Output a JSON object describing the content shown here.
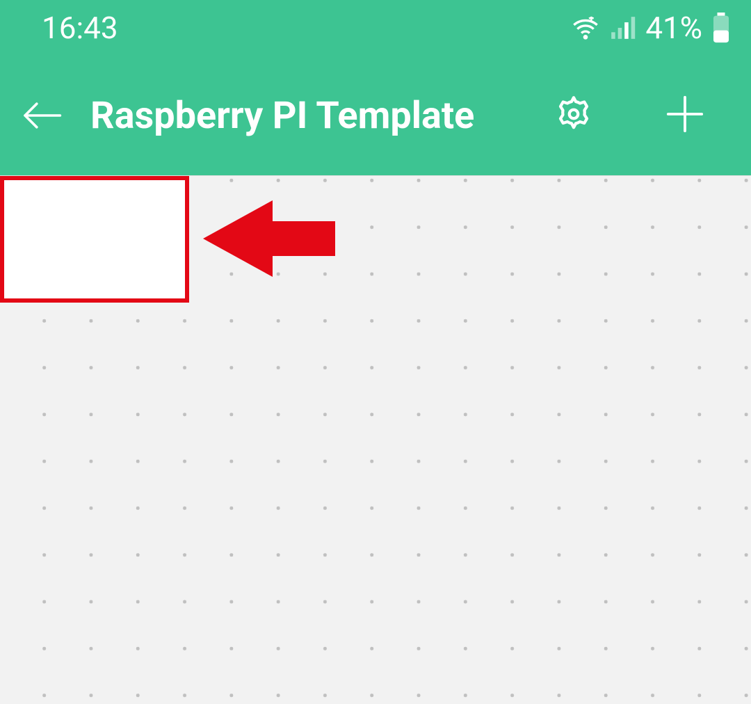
{
  "status_bar": {
    "time": "16:43",
    "battery_percent": "41%"
  },
  "app_bar": {
    "title": "Raspberry PI Template"
  },
  "colors": {
    "primary": "#3DC492",
    "annotation": "#E30815",
    "canvas_bg": "#F2F2F2"
  }
}
